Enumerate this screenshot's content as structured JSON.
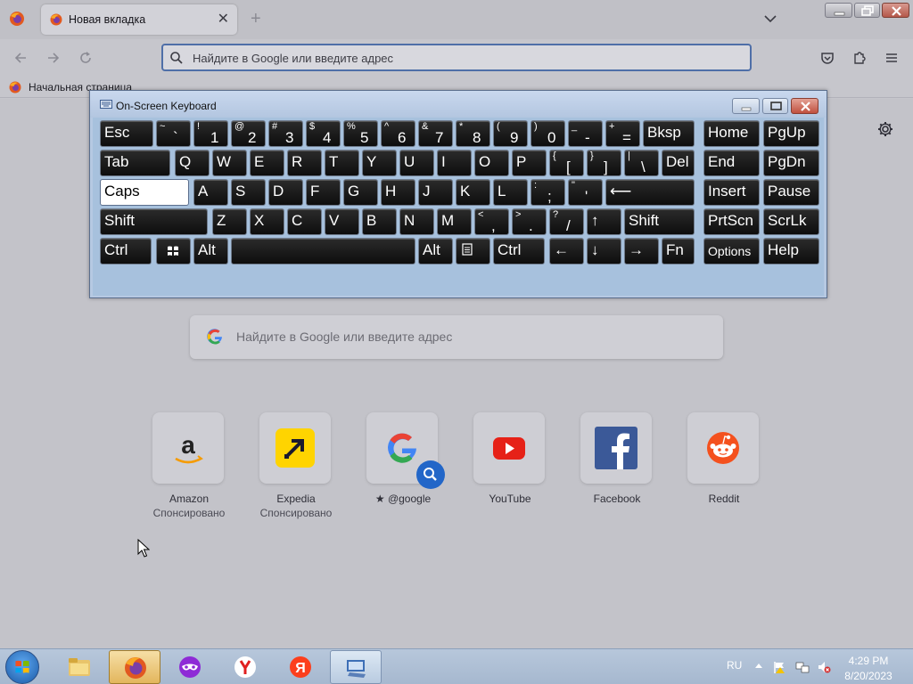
{
  "browser": {
    "tab_title": "Новая вкладка",
    "url_placeholder": "Найдите в Google или введите адрес",
    "bookmark_label": "Начальная страница"
  },
  "newtab": {
    "search_placeholder": "Найдите в Google или введите адрес",
    "tiles": [
      {
        "label": "Amazon",
        "sub": "Спонсировано",
        "icon": "amazon-logo"
      },
      {
        "label": "Expedia",
        "sub": "Спонсировано",
        "icon": "expedia-logo"
      },
      {
        "label": "@google",
        "sub": "",
        "icon": "google-logo"
      },
      {
        "label": "YouTube",
        "sub": "",
        "icon": "youtube-logo"
      },
      {
        "label": "Facebook",
        "sub": "",
        "icon": "facebook-logo"
      },
      {
        "label": "Reddit",
        "sub": "",
        "icon": "reddit-logo"
      }
    ]
  },
  "osk": {
    "title": "On-Screen Keyboard",
    "rows": [
      [
        {
          "l": "Esc"
        },
        {
          "s": "~",
          "m": "`"
        },
        {
          "s": "!",
          "m": "1"
        },
        {
          "s": "@",
          "m": "2"
        },
        {
          "s": "#",
          "m": "3"
        },
        {
          "s": "$",
          "m": "4"
        },
        {
          "s": "%",
          "m": "5"
        },
        {
          "s": "^",
          "m": "6"
        },
        {
          "s": "&",
          "m": "7"
        },
        {
          "s": "*",
          "m": "8"
        },
        {
          "s": "(",
          "m": "9"
        },
        {
          "s": ")",
          "m": "0"
        },
        {
          "s": "_",
          "m": "-"
        },
        {
          "s": "+",
          "m": "="
        },
        {
          "l": "Bksp"
        },
        {
          "l": "Home"
        },
        {
          "l": "PgUp"
        }
      ],
      [
        {
          "l": "Tab"
        },
        {
          "l": "Q"
        },
        {
          "l": "W"
        },
        {
          "l": "E"
        },
        {
          "l": "R"
        },
        {
          "l": "T"
        },
        {
          "l": "Y"
        },
        {
          "l": "U"
        },
        {
          "l": "I"
        },
        {
          "l": "O"
        },
        {
          "l": "P"
        },
        {
          "s": "{",
          "m": "["
        },
        {
          "s": "}",
          "m": "]"
        },
        {
          "s": "|",
          "m": "\\"
        },
        {
          "l": "Del"
        },
        {
          "l": "End"
        },
        {
          "l": "PgDn"
        }
      ],
      [
        {
          "l": "Caps",
          "active": true
        },
        {
          "l": "A"
        },
        {
          "l": "S"
        },
        {
          "l": "D"
        },
        {
          "l": "F"
        },
        {
          "l": "G"
        },
        {
          "l": "H"
        },
        {
          "l": "J"
        },
        {
          "l": "K"
        },
        {
          "l": "L"
        },
        {
          "s": ":",
          "m": ";"
        },
        {
          "s": "\"",
          "m": "'"
        },
        {
          "l": "⟵"
        },
        {
          "l": "Insert"
        },
        {
          "l": "Pause"
        }
      ],
      [
        {
          "l": "Shift"
        },
        {
          "l": "Z"
        },
        {
          "l": "X"
        },
        {
          "l": "C"
        },
        {
          "l": "V"
        },
        {
          "l": "B"
        },
        {
          "l": "N"
        },
        {
          "l": "M"
        },
        {
          "s": "<",
          "m": ","
        },
        {
          "s": ">",
          "m": "."
        },
        {
          "s": "?",
          "m": "/"
        },
        {
          "l": "↑"
        },
        {
          "l": "Shift"
        },
        {
          "l": "PrtScn"
        },
        {
          "l": "ScrLk"
        }
      ],
      [
        {
          "l": "Ctrl"
        },
        {
          "l": "",
          "icon": "windows-logo-icon"
        },
        {
          "l": "Alt"
        },
        {
          "l": ""
        },
        {
          "l": "Alt"
        },
        {
          "l": "",
          "icon": "menu-key-icon"
        },
        {
          "l": "Ctrl"
        },
        {
          "l": "←"
        },
        {
          "l": "↓"
        },
        {
          "l": "→"
        },
        {
          "l": "Fn"
        },
        {
          "l": "Options",
          "small": true
        },
        {
          "l": "Help"
        }
      ]
    ]
  },
  "taskbar": {
    "lang": "RU",
    "time": "4:29 PM",
    "date": "8/20/2023"
  }
}
